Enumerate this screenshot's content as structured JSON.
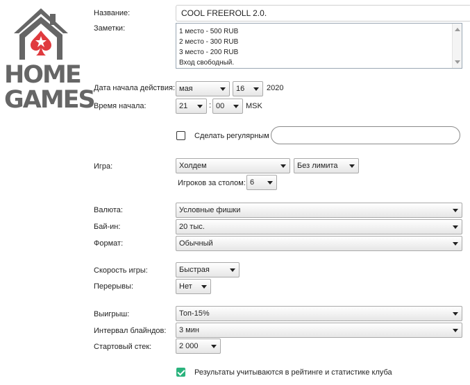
{
  "logo": {
    "line1": "HOME",
    "line2": "GAMES",
    "brand_color": "#e03a3e"
  },
  "name": {
    "label": "Название:",
    "value": "COOL FREEROLL 2.0."
  },
  "notes": {
    "label": "Заметки:",
    "lines": [
      "1 место - 500 RUB",
      "2 место - 300 RUB",
      "3 место - 200 RUB",
      "Вход свободный."
    ]
  },
  "start_date": {
    "label": "Дата начала действия:",
    "month": "мая",
    "day": "16",
    "year": "2020"
  },
  "start_time": {
    "label": "Время начала:",
    "hour": "21",
    "separator": ":",
    "minute": "00",
    "timezone": "MSK"
  },
  "recurring": {
    "label": "Сделать регулярным",
    "checked": false,
    "value": ""
  },
  "game": {
    "label": "Игра:",
    "type": "Холдем",
    "limit": "Без лимита",
    "players_label": "Игроков за столом:",
    "players": "6"
  },
  "currency": {
    "label": "Валюта:",
    "value": "Условные фишки"
  },
  "buyin": {
    "label": "Бай-ин:",
    "value": "20 тыс."
  },
  "format": {
    "label": "Формат:",
    "value": "Обычный"
  },
  "speed": {
    "label": "Скорость игры:",
    "value": "Быстрая"
  },
  "breaks": {
    "label": "Перерывы:",
    "value": "Нет"
  },
  "payout": {
    "label": "Выигрыш:",
    "value": "Топ-15%"
  },
  "blind_interval": {
    "label": "Интервал блайндов:",
    "value": "3 мин"
  },
  "starting_stack": {
    "label": "Стартовый стек:",
    "value": "2 000"
  },
  "stats": {
    "label": "Результаты учитываются в рейтинге и статистике клуба",
    "checked": true,
    "check_color": "#2ab37d"
  }
}
